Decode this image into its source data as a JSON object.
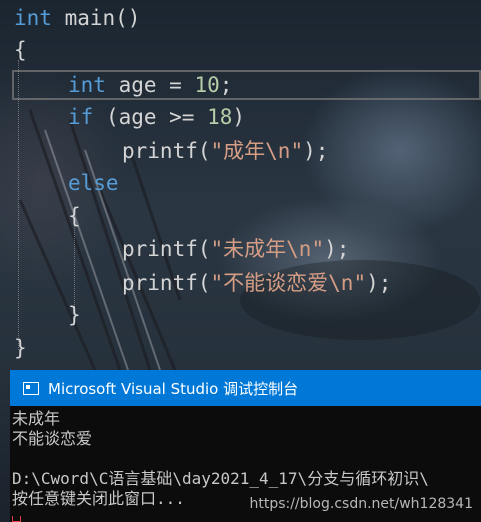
{
  "editor": {
    "lines": {
      "l1": {
        "kw": "int",
        "rest": " main()"
      },
      "l2": "{",
      "l3": {
        "kw": "int",
        "rest1": " age = ",
        "num": "10",
        "rest2": ";"
      },
      "l4": {
        "kw": "if",
        "rest1": " (age >= ",
        "num": "18",
        "rest2": ")"
      },
      "l5": {
        "fn": "printf(",
        "str": "\"成年\\n\"",
        "end": ");"
      },
      "l6": {
        "kw": "else"
      },
      "l7": "{",
      "l8": {
        "fn": "printf(",
        "str": "\"未成年\\n\"",
        "end": ");"
      },
      "l9": {
        "fn": "printf(",
        "str": "\"不能谈恋爱\\n\"",
        "end": ");"
      },
      "l10": "}",
      "l11": "}"
    }
  },
  "console": {
    "title": "Microsoft Visual Studio 调试控制台",
    "output": [
      "未成年",
      "不能谈恋爱",
      "",
      "D:\\Cword\\C语言基础\\day2021_4_17\\分支与循环初识\\",
      "按任意键关闭此窗口..."
    ]
  },
  "watermark": "https://blog.csdn.net/wh128341",
  "colors": {
    "keyword": "#569cd6",
    "number": "#b5cea8",
    "string": "#d69d85",
    "titlebar": "#0078d7",
    "console_bg": "#0c0c0c"
  }
}
